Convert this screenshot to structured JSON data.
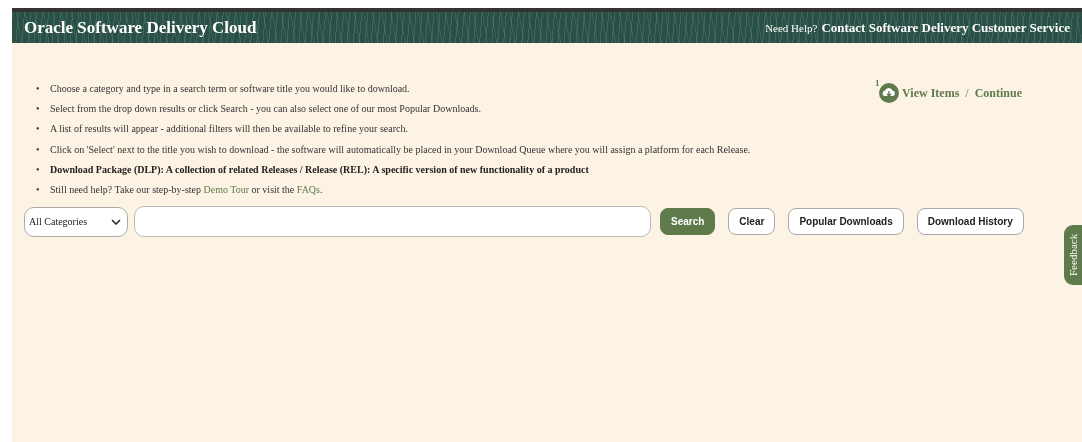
{
  "header": {
    "title": "Oracle Software Delivery Cloud",
    "help_prefix": "Need Help?",
    "help_link": "Contact Software Delivery Customer Service"
  },
  "cart": {
    "count": "1",
    "view": "View Items",
    "separator": "/",
    "continue": "Continue"
  },
  "instructions": [
    {
      "kind": "plain",
      "marker": "•",
      "text": "Choose a category and type in a search term or software title you would like to download."
    },
    {
      "kind": "plain",
      "marker": "•",
      "text": "Select from the drop down results or click Search - you can also select one of our most Popular Downloads."
    },
    {
      "kind": "plain",
      "marker": "•",
      "text": "A list of results will appear - additional filters will then be available to refine your search."
    },
    {
      "kind": "plain",
      "marker": "•",
      "text": "Click on 'Select' next to the title you wish to download - the software will automatically be placed in your Download Queue where you will assign a platform for each Release."
    },
    {
      "kind": "bold",
      "marker": "•",
      "text": "Download Package (DLP): A collection of related Releases / Release (REL): A specific version of new functionality of a product"
    },
    {
      "kind": "links",
      "marker": "•",
      "segments": [
        {
          "kind": "text",
          "text": "Still need help? Take our step-by-step "
        },
        {
          "kind": "link",
          "text": "Demo Tour"
        },
        {
          "kind": "text",
          "text": " or visit the "
        },
        {
          "kind": "link",
          "text": "FAQs"
        },
        {
          "kind": "text",
          "text": "."
        }
      ]
    }
  ],
  "search": {
    "category": "All Categories"
  },
  "buttons": [
    {
      "label": "Search",
      "kind": "primary"
    },
    {
      "label": "Clear",
      "kind": "secondary"
    },
    {
      "label": "Popular Downloads",
      "kind": "secondary"
    },
    {
      "label": "Download History",
      "kind": "secondary"
    }
  ],
  "feedback": "Feedback"
}
